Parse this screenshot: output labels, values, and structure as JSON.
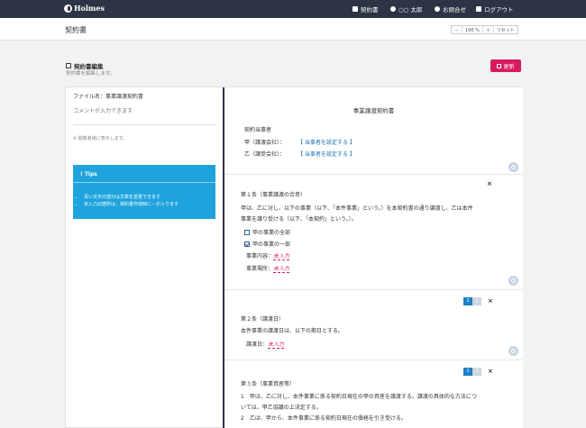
{
  "topbar": {
    "logo": "Holmes",
    "nav": [
      {
        "label": "契約書",
        "icon": "document-icon"
      },
      {
        "label": "○○ 太郎",
        "icon": "user-icon"
      },
      {
        "label": "お問合せ",
        "icon": "chat-icon"
      },
      {
        "label": "ログアウト",
        "icon": "logout-icon"
      }
    ]
  },
  "page": {
    "title": "契約書",
    "zoom": {
      "minus": "－",
      "value": "100 %",
      "plus": "＋",
      "reset": "リセット"
    }
  },
  "edit": {
    "title": "契約書編集",
    "subtitle": "契約書を編集します。",
    "update_label": "更新"
  },
  "left": {
    "filename": "ファイル名：事業譲渡契約書",
    "comment_placeholder": "コメントが入力できます",
    "comment_note": "※ 閲覧者様に表示します。",
    "tips": {
      "title": "! Tips",
      "items": [
        "青い文字の部分は文章を変更できます",
        "未入力の箇所は、契約書作成時に－が入ります"
      ]
    }
  },
  "doc": {
    "title": "事業譲渡契約書",
    "parties_label": "契約当事者",
    "party_a": "甲（譲渡会社）：",
    "party_b": "乙（譲受会社）：",
    "set_party": "【 当事者を設定する 】",
    "art1": {
      "heading": "第１条（事業譲渡の合意）",
      "line1": "甲は、乙に対し、以下の事業（以下、「本件事業」という。）を本契約書の通り譲渡し、乙は本件",
      "line2": "事業を譲り受ける（以下、「本契約」という。）。",
      "option1": "甲の事業の全部",
      "option2": "甲の事業の一部",
      "content_label": "事業内容：",
      "place_label": "事業場所：",
      "empty": "未入力"
    },
    "art2": {
      "heading": "第２条（譲渡日）",
      "line1": "本件事業の譲渡日は、以下の期日とする。",
      "date_label": "譲渡日：",
      "empty": "未入力"
    },
    "art3": {
      "heading": "第３条（事業資産等）",
      "line1": "1　甲は、乙に対し、本件事業に係る契約日現在の甲の資産を譲渡する。譲渡の具体的な方法につ",
      "line2": "いては、甲乙協議の上決定する。",
      "line3": "2　乙は、甲から、本件事業に係る契約日現在の債務を引き受ける。"
    },
    "pager": [
      "1",
      "2"
    ],
    "close": "×"
  }
}
